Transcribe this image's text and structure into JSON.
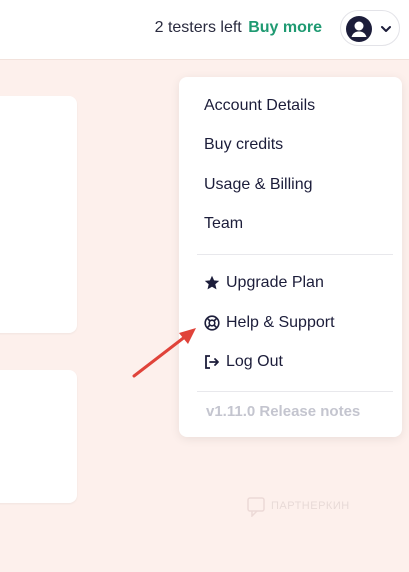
{
  "header": {
    "testers_left": "2 testers left",
    "buy_more": "Buy more"
  },
  "avatar_icon": "user-circle-icon",
  "dropdown_icon": "chevron-down-icon",
  "menu": {
    "account_details": "Account Details",
    "buy_credits": "Buy credits",
    "usage_billing": "Usage & Billing",
    "team": "Team",
    "upgrade_plan": "Upgrade Plan",
    "help_support": "Help & Support",
    "log_out": "Log Out",
    "release_notes": "v1.11.0 Release notes"
  },
  "icons": {
    "upgrade": "star-icon",
    "help": "lifebuoy-icon",
    "logout": "logout-icon"
  },
  "colors": {
    "accent": "#1f9a72",
    "annotation_arrow": "#e0433a",
    "background": "#fdf0ec"
  },
  "watermark": "ПАРТНЕРКИН"
}
